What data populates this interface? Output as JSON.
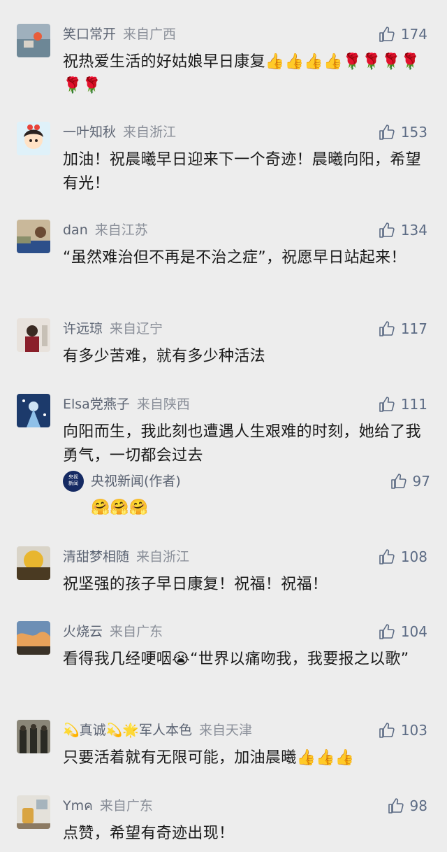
{
  "comments": [
    {
      "name": "笑口常开",
      "loc": "来自广西",
      "likes": "174",
      "text": "祝热爱生活的好姑娘早日康复👍👍👍👍🌹🌹🌹🌹🌹🌹"
    },
    {
      "name": "一叶知秋",
      "loc": "来自浙江",
      "likes": "153",
      "text": "加油！祝晨曦早日迎来下一个奇迹！晨曦向阳，希望有光！"
    },
    {
      "name": "dan",
      "loc": "来自江苏",
      "likes": "134",
      "text": "“虽然难治但不再是不治之症”，祝愿早日站起来！"
    },
    {
      "name": "许远琼",
      "loc": "来自辽宁",
      "likes": "117",
      "text": "有多少苦难，就有多少种活法"
    },
    {
      "name": "Elsa党燕子",
      "loc": "来自陕西",
      "likes": "111",
      "text": "向阳而生，我此刻也遭遇人生艰难的时刻，她给了我勇气，一切都会过去"
    },
    {
      "name": "清甜梦相随",
      "loc": "来自浙江",
      "likes": "108",
      "text": "祝坚强的孩子早日康复！祝福！祝福！"
    },
    {
      "name": "火烧云",
      "loc": "来自广东",
      "likes": "104",
      "text": "看得我几经哽咽😭“世界以痛吻我，我要报之以歌”"
    },
    {
      "name": "💫真诚💫🌟军人本色",
      "loc": "来自天津",
      "likes": "103",
      "text": "只要活着就有无限可能，加油晨曦👍👍👍"
    },
    {
      "name": "Ymค",
      "loc": "来自广东",
      "likes": "98",
      "text": "点赞，希望有奇迹出现！"
    }
  ],
  "reply": {
    "avatar_text": "央视新闻",
    "name": "央视新闻(作者)",
    "likes": "97",
    "text": "🤗🤗🤗"
  },
  "colors": {
    "background": "#ededed",
    "meta": "#5c6473",
    "like": "#5c6b84"
  }
}
